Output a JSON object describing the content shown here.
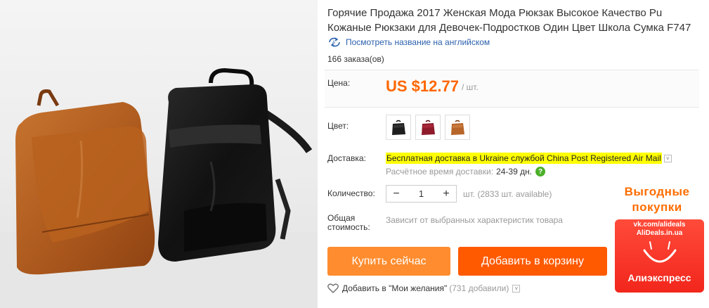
{
  "product": {
    "title_line1": "Горячие Продажа 2017 Женская Мода Рюкзак Высокое Качество Pu",
    "title_line2": "Кожаные Рюкзаки для Девочек-Подростков Один Цвет Школа Сумка F747",
    "translate_link": "Посмотреть название на английском",
    "translate_icon": "translate-icon",
    "orders": "166 заказа(ов)"
  },
  "price": {
    "label": "Цена:",
    "value": "US $12.77",
    "unit": "/ шт."
  },
  "color": {
    "label": "Цвет:",
    "options": [
      {
        "name": "black",
        "color": "#1e1e1e"
      },
      {
        "name": "red",
        "color": "#8e1a2a"
      },
      {
        "name": "brown",
        "color": "#b8652a"
      }
    ]
  },
  "shipping": {
    "label": "Доставка:",
    "text_1": "Бесплатная доставка в",
    "country": "Ukraine",
    "text_2": "службой",
    "service": "China Post Registered Air Mail",
    "caret": "˅",
    "delivery_label": "Расчётное время доставки:",
    "delivery_value": "24-39 дн.",
    "help_symbol": "?"
  },
  "quantity": {
    "label": "Количество:",
    "minus": "−",
    "value": "1",
    "plus": "+",
    "available": "шт. (2833 шт. available)"
  },
  "total": {
    "label_line1": "Общая",
    "label_line2": "стоимость:",
    "note": "Зависит от выбранных характеристик товара"
  },
  "buttons": {
    "buy_now": "Купить сейчас",
    "add_to_cart": "Добавить в корзину"
  },
  "wishlist": {
    "label": "Добавить в \"Мои желания\"",
    "count": "(731 добавили)",
    "caret": "˅"
  },
  "promo": {
    "line1": "Выгодные",
    "line2": "покупки",
    "vk": "vk.com/alideals",
    "domain": "AliDeals.in.ua",
    "brand": "Алиэкспресс"
  },
  "colors": {
    "price_orange": "#ff6700",
    "buy_button": "#ff8c2e",
    "cart_button": "#ff5a00",
    "link_blue": "#2a5fac",
    "highlight": "#ffff00",
    "promo_red": "#f2261c"
  }
}
